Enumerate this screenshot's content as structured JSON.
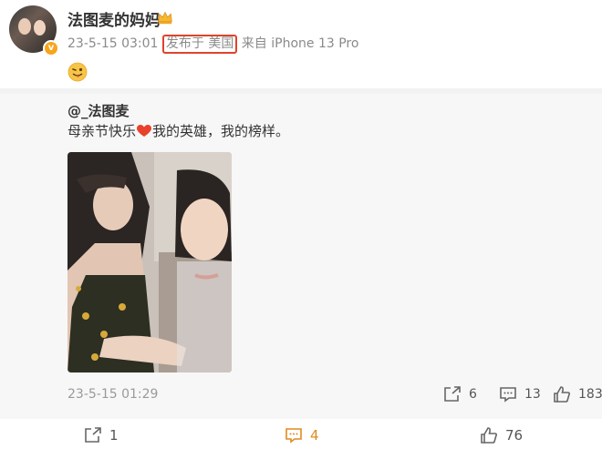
{
  "post": {
    "username": "法图麦的妈妈",
    "time": "23-5-15 03:01",
    "location": "发布于 美国",
    "device": "来自 iPhone 13 Pro",
    "avatar_icon": "avatar",
    "badge_icon": "verified-badge-icon",
    "crown_icon": "crown-icon",
    "emoji": "tongue-out-emoji"
  },
  "repost": {
    "author": "@_法图麦",
    "text_before": "母亲节快乐",
    "heart_icon": "red-heart-emoji",
    "text_after": "我的英雄，我的榜样。",
    "time": "23-5-15 01:29",
    "actions": {
      "share_count": "6",
      "comment_count": "13",
      "like_count": "183"
    }
  },
  "bottom": {
    "share_count": "1",
    "comment_count": "4",
    "like_count": "76"
  },
  "colors": {
    "highlight_box": "#e0432b",
    "comment_accent": "#e08a1e",
    "repost_background": "#f7f7f7"
  }
}
